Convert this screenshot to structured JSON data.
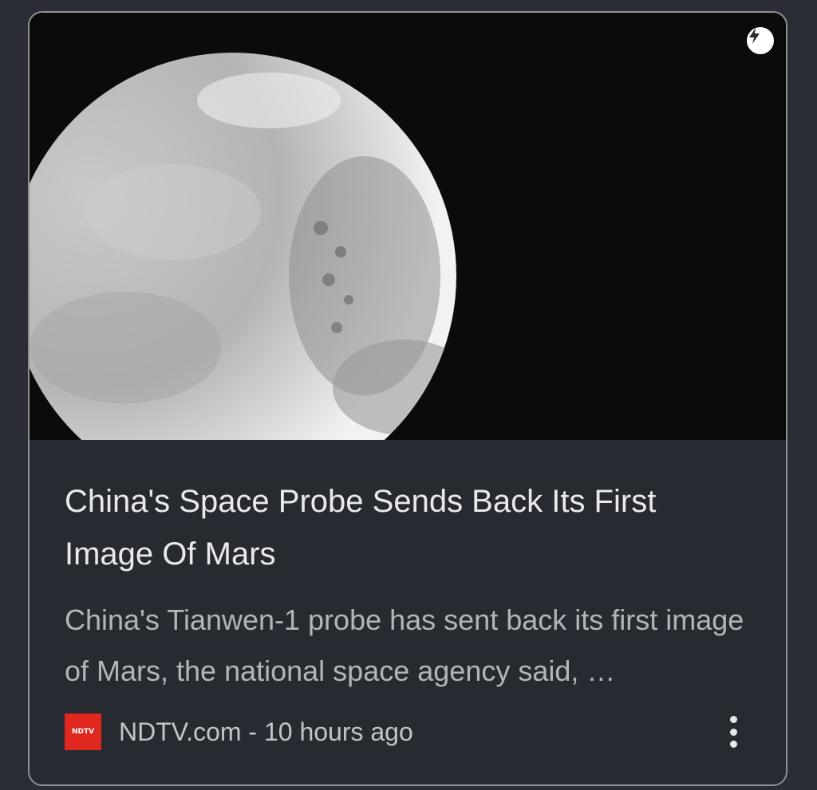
{
  "article": {
    "image_icon": "amp-lightning-icon",
    "image_subject": "mars-planet-image",
    "headline": "China's Space Probe Sends Back Its First Image Of Mars",
    "snippet": "China's Tianwen-1 probe has sent back its first image of Mars, the national space agency said, …",
    "source_logo_text": "NDTV",
    "meta": "NDTV.com - 10 hours ago",
    "more_icon": "more-vertical-icon"
  },
  "colors": {
    "background": "#2a2d35",
    "card_border": "#8e9096",
    "headline_text": "#e9eaec",
    "snippet_text": "#b3b5ba",
    "source_logo_bg": "#e0281e"
  }
}
